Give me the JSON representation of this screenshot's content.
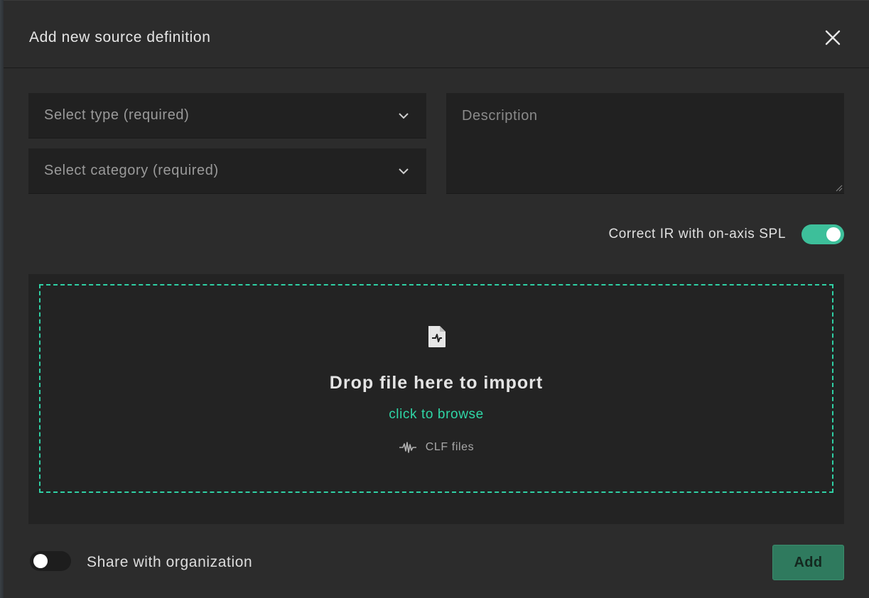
{
  "dialog": {
    "title": "Add new source definition",
    "close_icon": "close-icon"
  },
  "form": {
    "type_select": {
      "placeholder": "Select type (required)",
      "icon": "chevron-down-icon"
    },
    "category_select": {
      "placeholder": "Select category (required)",
      "icon": "chevron-down-icon"
    },
    "description": {
      "placeholder": "Description",
      "value": ""
    },
    "correct_ir": {
      "label": "Correct IR with on-axis SPL",
      "checked": true
    }
  },
  "dropzone": {
    "icon": "file-waveform-icon",
    "title": "Drop file here to import",
    "browse_label": "click to browse",
    "filetype_icon": "waveform-icon",
    "filetype_label": "CLF files"
  },
  "footer": {
    "share": {
      "label": "Share with organization",
      "checked": false
    },
    "add_label": "Add"
  },
  "colors": {
    "accent": "#2fd6a6",
    "toggle_on": "#3dbf9a",
    "add_button": "#2f7a5e",
    "modal_bg": "#2c2c2c",
    "field_bg": "#212121"
  }
}
